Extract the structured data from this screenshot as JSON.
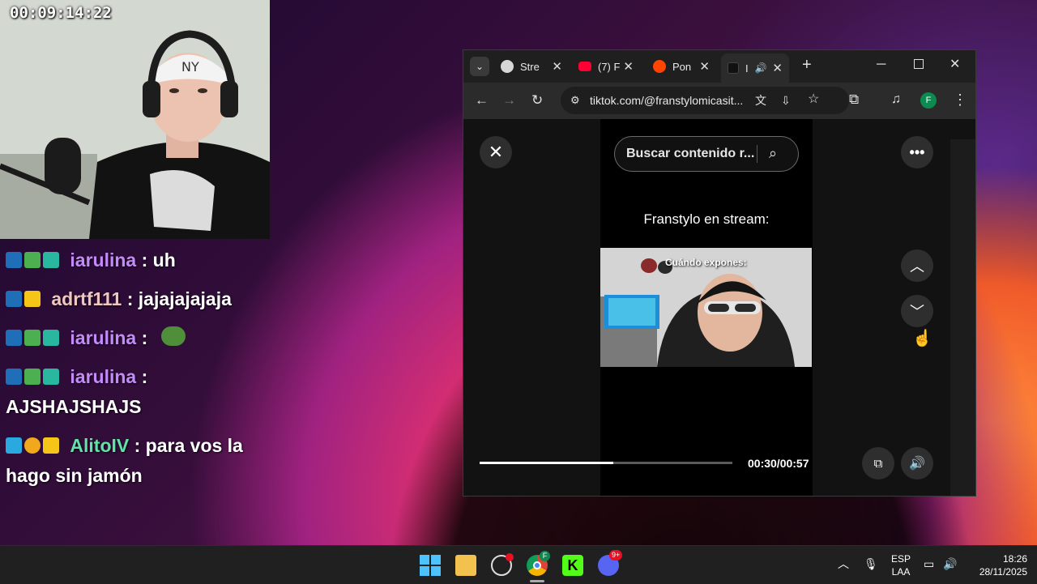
{
  "stream": {
    "timer": "00:09:14:22"
  },
  "chat": {
    "messages": [
      {
        "user": "iarulina",
        "text": ": uh",
        "user_color": "#c58af9",
        "badges": [
          "mod-sword",
          "creeper",
          "sub-badge"
        ]
      },
      {
        "user": "adrtf111",
        "text": ": jajajajajaja",
        "user_color": "#f1c6c0",
        "badges": [
          "mod-sword",
          "crown"
        ]
      },
      {
        "user": "iarulina",
        "text": ":",
        "user_color": "#c58af9",
        "badges": [
          "mod-sword",
          "creeper",
          "sub-badge"
        ],
        "emote": "pepe-emote"
      },
      {
        "user": "iarulina",
        "text": ":",
        "line2": "AJSHAJSHAJS",
        "user_color": "#c58af9",
        "badges": [
          "mod-sword",
          "creeper",
          "sub-badge"
        ]
      },
      {
        "user": "AlitoIV",
        "text": ": para vos la",
        "line2": "hago sin jamón",
        "user_color": "#5fe3a8",
        "badges": [
          "cube",
          "one-coin",
          "crown"
        ]
      }
    ]
  },
  "browser": {
    "tabs": [
      {
        "label": "Stre",
        "icon": "stream-favicon"
      },
      {
        "label": "(7) F",
        "icon": "youtube-favicon"
      },
      {
        "label": "Pon",
        "icon": "reddit-favicon"
      },
      {
        "label": "I",
        "icon": "tiktok-favicon",
        "active": true
      }
    ],
    "address": "tiktok.com/@franstylomicasit...",
    "profile_initial": "F"
  },
  "tiktok": {
    "search_placeholder": "Buscar contenido r...",
    "caption": "Franstylo en stream:",
    "video_overlay": "Cuándo expones:",
    "time": "00:30/00:57",
    "progress": 0.53
  },
  "taskbar": {
    "lang_top": "ESP",
    "lang_bottom": "LAA",
    "time": "18:26",
    "date": "28/11/2025",
    "discord_badge": "9+",
    "chrome_profile": "F"
  },
  "colors": {
    "accent_green": "#0d8a4f",
    "tiktok_bg": "#000000"
  }
}
